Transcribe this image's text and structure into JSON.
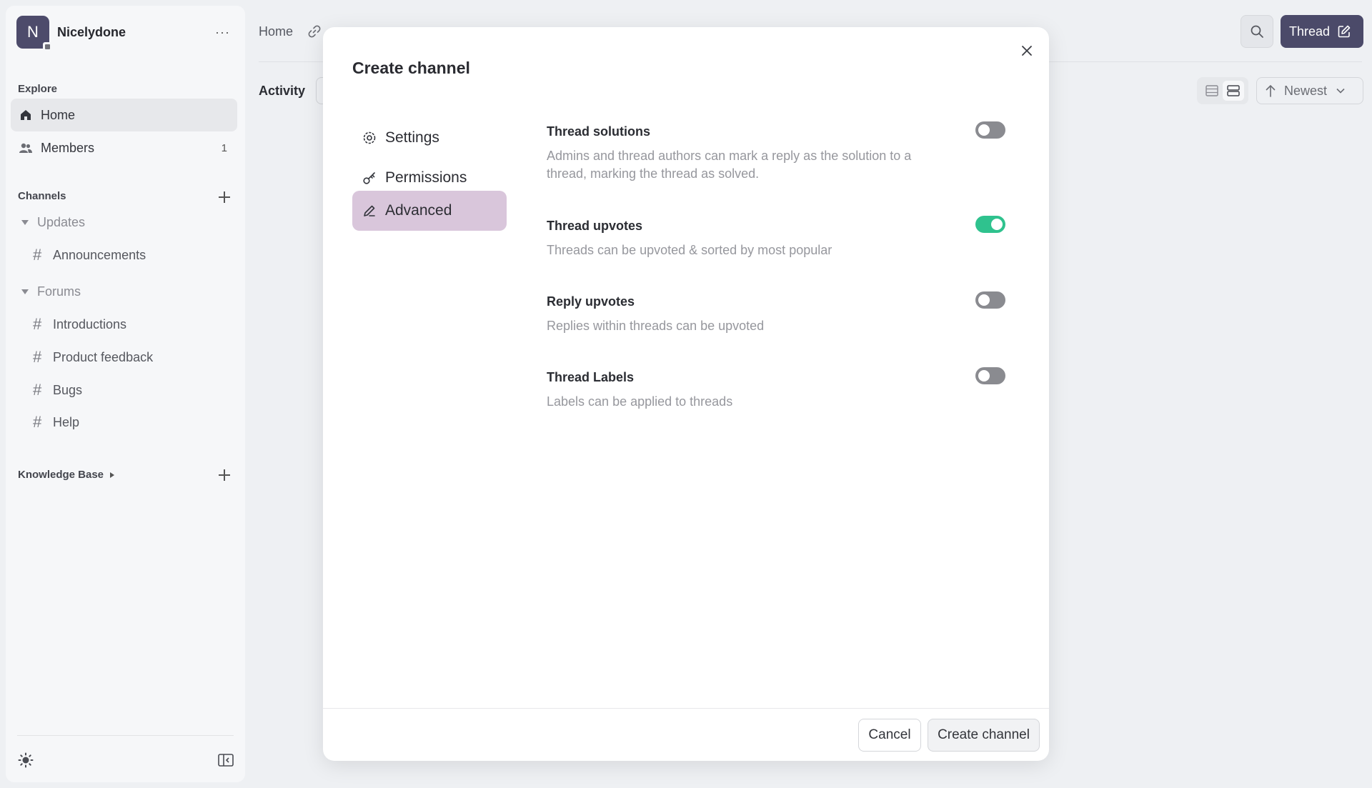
{
  "workspace": {
    "initial": "N",
    "name": "Nicelydone",
    "more": "···"
  },
  "sidebar": {
    "explore_label": "Explore",
    "nav": [
      {
        "label": "Home",
        "icon": "home-icon",
        "active": true
      },
      {
        "label": "Members",
        "icon": "members-icon",
        "count": "1"
      }
    ],
    "channels_label": "Channels",
    "groups": [
      {
        "label": "Updates",
        "channels": [
          "Announcements"
        ]
      },
      {
        "label": "Forums",
        "channels": [
          "Introductions",
          "Product feedback",
          "Bugs",
          "Help"
        ]
      }
    ],
    "knowledge_base_label": "Knowledge Base"
  },
  "header": {
    "breadcrumb": "Home",
    "thread_button": "Thread"
  },
  "main": {
    "activity_label": "Activity",
    "sort_label": "Newest"
  },
  "modal": {
    "title": "Create channel",
    "tabs": [
      {
        "label": "Settings",
        "icon": "gear-icon"
      },
      {
        "label": "Permissions",
        "icon": "key-icon"
      },
      {
        "label": "Advanced",
        "icon": "pen-icon",
        "active": true
      }
    ],
    "options": [
      {
        "title": "Thread solutions",
        "description": "Admins and thread authors can mark a reply as the solution to a thread, marking the thread as solved.",
        "enabled": false
      },
      {
        "title": "Thread upvotes",
        "description": "Threads can be upvoted & sorted by most popular",
        "enabled": true
      },
      {
        "title": "Reply upvotes",
        "description": "Replies within threads can be upvoted",
        "enabled": false
      },
      {
        "title": "Thread Labels",
        "description": "Labels can be applied to threads",
        "enabled": false
      }
    ],
    "cancel_label": "Cancel",
    "create_label": "Create channel"
  },
  "colors": {
    "accent": "#4b4a69",
    "toggle_on": "#2fc28e",
    "active_tab": "#d9c6db"
  }
}
